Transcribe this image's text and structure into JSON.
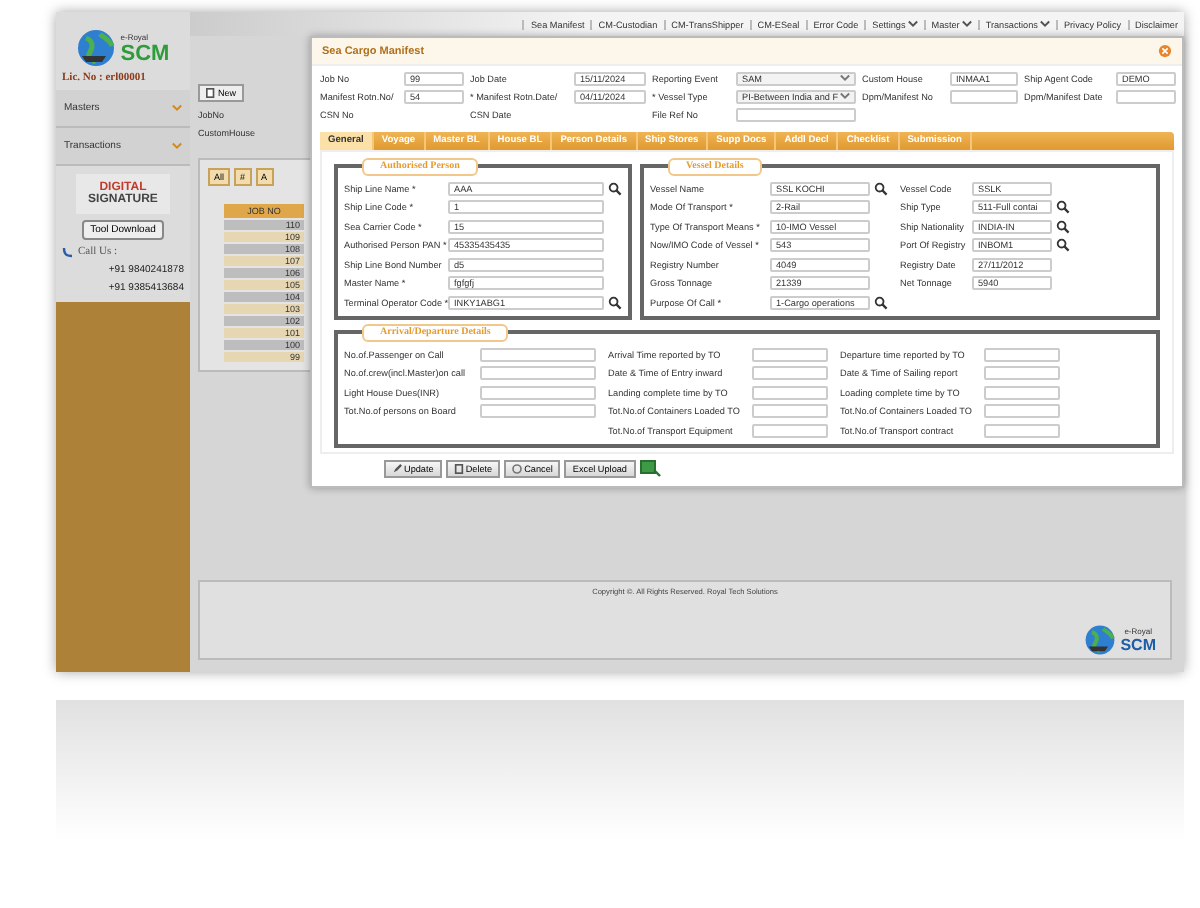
{
  "top_nav": [
    {
      "label": "Sea Manifest",
      "dropdown": false
    },
    {
      "label": "CM-Custodian",
      "dropdown": false
    },
    {
      "label": "CM-TransShipper",
      "dropdown": false
    },
    {
      "label": "CM-ESeal",
      "dropdown": false
    },
    {
      "label": "Error Code",
      "dropdown": false
    },
    {
      "label": "Settings",
      "dropdown": true
    },
    {
      "label": "Master",
      "dropdown": true
    },
    {
      "label": "Transactions",
      "dropdown": true
    },
    {
      "label": "Privacy Policy",
      "dropdown": false
    },
    {
      "label": "Disclaimer",
      "dropdown": false
    }
  ],
  "sidebar": {
    "logo_small": "e-Royal",
    "logo_big": "SCM",
    "license": "Lic. No : erl00001",
    "menu": [
      {
        "label": "Masters",
        "expanded": false
      },
      {
        "label": "Transactions",
        "expanded": false
      }
    ],
    "signature_line1": "DIGITAL",
    "signature_line2": "SIGNATURE",
    "tool_button": "Tool Download",
    "call_label": "Call Us :",
    "phones": [
      "+91 9840241878",
      "+91 9385413684"
    ]
  },
  "background": {
    "new_button": "New",
    "filters": [
      "JobNo",
      "CustomHouse"
    ],
    "grid_filters": [
      "All",
      "#",
      "A"
    ],
    "grid_column": "JOB NO",
    "grid_rows": [
      "110",
      "109",
      "108",
      "107",
      "106",
      "105",
      "104",
      "103",
      "102",
      "101",
      "100",
      "99"
    ],
    "copyright": "Copyright ©. All Rights Reserved. Royal Tech Solutions",
    "brand_small": "e-Royal",
    "brand_big": "SCM"
  },
  "dialog": {
    "title": "Sea Cargo Manifest",
    "header_rows": [
      [
        {
          "label": "Job No",
          "kind": "text",
          "value": "99"
        },
        {
          "label": "Job Date",
          "kind": "text",
          "value": "15/11/2024"
        },
        {
          "label": "Reporting Event",
          "kind": "select",
          "value": "SAM"
        },
        {
          "label": "Custom House",
          "kind": "text",
          "value": "INMAA1"
        },
        {
          "label": "Ship Agent Code",
          "kind": "text",
          "value": "DEMO"
        }
      ],
      [
        {
          "label": "Manifest Rotn.No/",
          "kind": "text",
          "value": "54"
        },
        {
          "label": "* Manifest Rotn.Date/",
          "kind": "text",
          "value": "04/11/2024"
        },
        {
          "label": "* Vessel Type",
          "kind": "select",
          "value": "PI-Between India and F"
        },
        {
          "label": "Dpm/Manifest No",
          "kind": "text"
        },
        {
          "label": "Dpm/Manifest Date",
          "kind": "text"
        }
      ],
      [
        {
          "label": "CSN No",
          "kind": "label"
        },
        {
          "label": "CSN Date",
          "kind": "label"
        },
        {
          "label": "File Ref No",
          "kind": "text"
        }
      ]
    ],
    "tabs": [
      {
        "label": "General",
        "selected": true
      },
      {
        "label": "Voyage",
        "selected": false
      },
      {
        "label": "Master BL",
        "selected": false
      },
      {
        "label": "House BL",
        "selected": false
      },
      {
        "label": "Person Details",
        "selected": false
      },
      {
        "label": "Ship Stores",
        "selected": false
      },
      {
        "label": "Supp Docs",
        "selected": false
      },
      {
        "label": "Addl Decl",
        "selected": false
      },
      {
        "label": "Checklist",
        "selected": false
      },
      {
        "label": "Submission",
        "selected": false
      }
    ],
    "authorised_person": {
      "legend": "Authorised Person",
      "fields": [
        {
          "label": "Ship Line Name *",
          "value": "AAA",
          "lookup": true
        },
        {
          "label": "Ship Line Code *",
          "value": "1",
          "lookup": false
        },
        {
          "label": "Sea Carrier Code *",
          "value": "15",
          "lookup": false
        },
        {
          "label": "Authorised Person PAN *",
          "value": "45335435435",
          "lookup": false
        },
        {
          "label": "Ship Line Bond Number",
          "value": "d5",
          "lookup": false
        },
        {
          "label": "Master Name *",
          "value": "fgfgfj",
          "lookup": false
        },
        {
          "label": "Terminal Operator Code *",
          "value": "INKY1ABG1",
          "lookup": true
        }
      ]
    },
    "vessel_details": {
      "legend": "Vessel Details",
      "columns": [
        [
          {
            "label": "Vessel Name",
            "value": "SSL KOCHI",
            "lookup": true
          },
          {
            "label": "Mode Of Transport *",
            "value": "2-Rail",
            "lookup": false
          },
          {
            "label": "Type Of Transport Means *",
            "value": "10-IMO Vessel",
            "lookup": false
          },
          {
            "label": "Now/IMO Code of Vessel *",
            "value": "543",
            "lookup": false
          },
          {
            "label": "Registry Number",
            "value": "4049",
            "lookup": false
          },
          {
            "label": "Gross Tonnage",
            "value": "21339",
            "lookup": false
          },
          {
            "label": "Purpose Of Call *",
            "value": "1-Cargo operations",
            "lookup": true
          }
        ],
        [
          {
            "label": "Vessel Code",
            "value": "SSLK",
            "lookup": false
          },
          {
            "label": "Ship Type",
            "value": "511-Full contai",
            "lookup": true
          },
          {
            "label": "Ship Nationality",
            "value": "INDIA-IN",
            "lookup": true
          },
          {
            "label": "Port Of Registry",
            "value": "INBOM1",
            "lookup": true
          },
          {
            "label": "Registry Date",
            "value": "27/11/2012",
            "lookup": false
          },
          {
            "label": "Net Tonnage",
            "value": "5940",
            "lookup": false
          }
        ]
      ]
    },
    "arrival_departure": {
      "legend": "Arrival/Departure Details",
      "columns": [
        [
          "No.of.Passenger on Call",
          "No.of.crew(incl.Master)on call",
          "Light House Dues(INR)",
          "Tot.No.of persons on Board"
        ],
        [
          "Arrival Time reported by TO",
          "Date & Time of Entry inward",
          "Landing complete time by TO",
          "Tot.No.of Containers Loaded TO",
          "Tot.No.of Transport Equipment"
        ],
        [
          "Departure time reported by TO",
          "Date & Time of Sailing report",
          "Loading complete time by TO",
          "Tot.No.of Containers Loaded TO",
          "Tot.No.of Transport contract"
        ]
      ]
    },
    "buttons": [
      {
        "label": "Update",
        "kind": "edit"
      },
      {
        "label": "Delete",
        "kind": "delete"
      },
      {
        "label": "Cancel",
        "kind": "cancel"
      },
      {
        "label": "Excel Upload",
        "kind": "plain"
      }
    ]
  }
}
